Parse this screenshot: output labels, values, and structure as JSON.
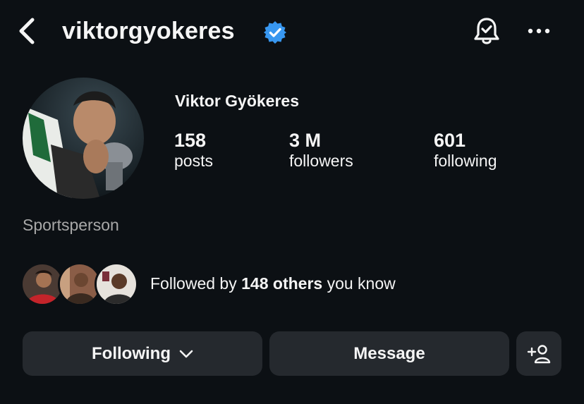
{
  "header": {
    "username": "viktorgyokeres",
    "verified": true,
    "icons": [
      "back-arrow-icon",
      "verified-badge-icon",
      "notification-bell-icon",
      "more-options-icon"
    ]
  },
  "profile": {
    "display_name": "Viktor Gyökeres",
    "stats": {
      "posts_value": "158",
      "posts_label": "posts",
      "followers_value": "3 M",
      "followers_label": "followers",
      "following_value": "601",
      "following_label": "following"
    },
    "category": "Sportsperson"
  },
  "followed_by": {
    "prefix": "Followed by ",
    "count": "148 others",
    "suffix": " you know"
  },
  "actions": {
    "following_label": "Following",
    "message_label": "Message",
    "add_user_icon": "add-person-icon"
  },
  "colors": {
    "background": "#0c1014",
    "button": "#25292e",
    "verified": "#3897f0",
    "secondary_text": "#a8a8a8"
  }
}
